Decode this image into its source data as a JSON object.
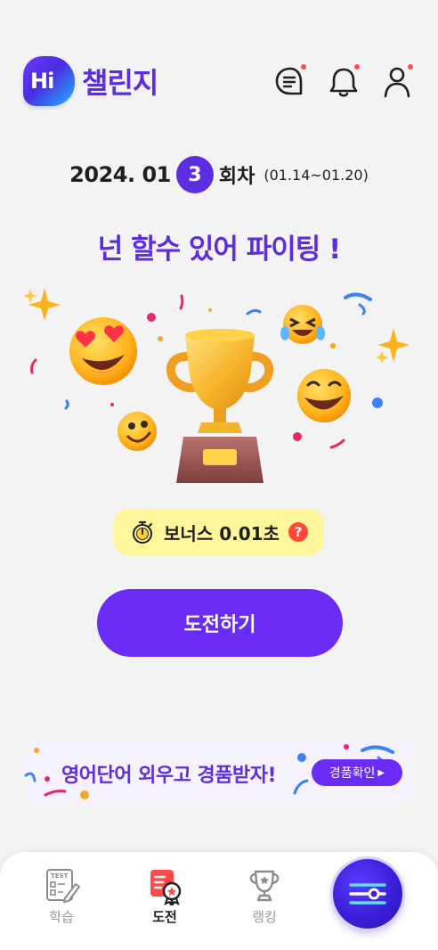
{
  "header": {
    "logo_text": "Hi",
    "title": "챌린지",
    "icons": [
      "chat-icon",
      "bell-icon",
      "profile-icon"
    ]
  },
  "round": {
    "year_month": "2024. 01",
    "number": "3",
    "suffix": "회차",
    "range": "(01.14~01.20)"
  },
  "slogan": "넌 할수 있어 파이팅 !",
  "bonus": {
    "text": "보너스 0.01초",
    "help": "?"
  },
  "challenge_button": "도전하기",
  "promo": {
    "text": "영어단어 외우고 경품받자!",
    "button": "경품확인"
  },
  "nav": {
    "items": [
      {
        "label": "학습",
        "icon": "test-icon"
      },
      {
        "label": "도전",
        "icon": "challenge-icon"
      },
      {
        "label": "랭킹",
        "icon": "trophy-icon"
      }
    ],
    "test_tag": "TEST",
    "fab_icon": "sliders-icon"
  },
  "colors": {
    "brand": "#5b2fe0",
    "button": "#6a2cf5",
    "bonus_bg": "#fff59b",
    "badge": "#ff4a3a"
  }
}
